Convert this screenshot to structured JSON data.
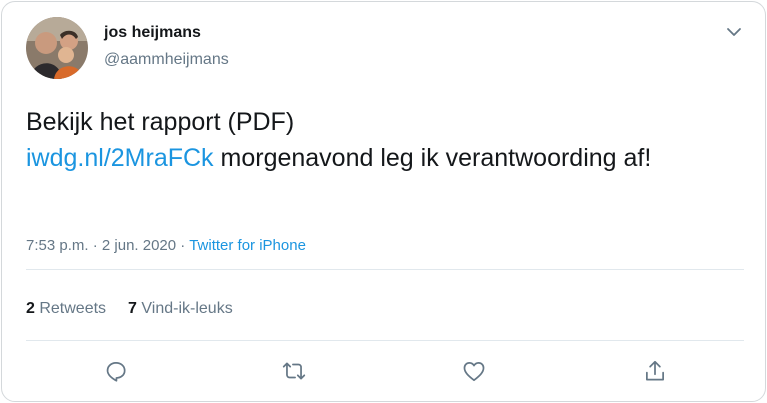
{
  "author": {
    "name": "jos heijmans",
    "handle": "@aammheijmans"
  },
  "tweet": {
    "line1": "Bekijk het rapport (PDF)",
    "link_text": "iwdg.nl/2MraFCk",
    "line2_rest": " morgenavond leg ik verantwoording af!"
  },
  "meta": {
    "time": "7:53 p.m.",
    "separator1": " · ",
    "date": "2 jun. 2020",
    "separator2": " · ",
    "source": "Twitter for iPhone"
  },
  "stats": {
    "retweets_count": "2",
    "retweets_label": " Retweets",
    "likes_count": "7",
    "likes_label": " Vind-ik-leuks"
  },
  "icons": {
    "reply": "reply-icon",
    "retweet": "retweet-icon",
    "like": "heart-icon",
    "share": "share-icon",
    "menu": "chevron-down-icon"
  },
  "colors": {
    "link": "#1b95e0",
    "secondary_text": "#657786",
    "primary_text": "#14171a"
  }
}
